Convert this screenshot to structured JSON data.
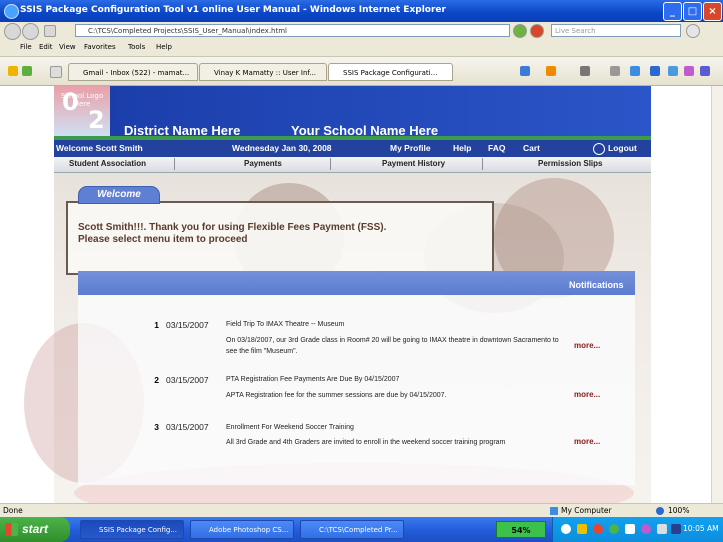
{
  "window": {
    "title": "SSIS Package Configuration Tool v1 online User Manual - Windows Internet Explorer",
    "address": "C:\\TCS\\Completed Projects\\SSIS_User_Manual\\index.html",
    "search_placeholder": "Live Search"
  },
  "menu": [
    "File",
    "Edit",
    "View",
    "Favorites",
    "Tools",
    "Help"
  ],
  "tabs": [
    {
      "label": "Gmail - Inbox (522) - mamat..."
    },
    {
      "label": "Vinay K Mamatty :: User Inf..."
    },
    {
      "label": "SSIS Package Configurati...",
      "active": true
    }
  ],
  "site": {
    "logo_text": "School Logo Here",
    "logo_digits": [
      "0",
      "2"
    ],
    "district": "District Name Here",
    "school": "Your School Name Here",
    "welcome_user": "Welcome Scott Smith",
    "date": "Wednesday Jan 30, 2008",
    "links": [
      "My Profile",
      "Help",
      "FAQ",
      "Cart"
    ],
    "logout": "Logout",
    "nav": [
      "Student Association",
      "Payments",
      "Payment History",
      "Permission Slips"
    ],
    "welcome_tab": "Welcome",
    "welcome_line1": "Scott Smith!!!. Thank you for using Flexible Fees Payment (FSS).",
    "welcome_line2": "Please select menu item to proceed",
    "notifications_title": "Notifications",
    "notifications": [
      {
        "num": "1",
        "date": "03/15/2007",
        "title": "Field Trip To IMAX Theatre -- Museum",
        "desc": "On 03/18/2007, our 3rd Grade class in Room# 20 will be going to IMAX theatre in downtown Sacramento to see the film \"Museum\".",
        "more": "more..."
      },
      {
        "num": "2",
        "date": "03/15/2007",
        "title": "PTA Registration Fee Payments Are Due By 04/15/2007",
        "desc": "APTA Registration fee for the summer sessions are due by 04/15/2007.",
        "more": "more..."
      },
      {
        "num": "3",
        "date": "03/15/2007",
        "title": "Enrollment For Weekend Soccer Training",
        "desc": "All 3rd Grade and 4th Graders are invited to enroll in the weekend soccer training program",
        "more": "more..."
      }
    ]
  },
  "status": {
    "left": "Done",
    "zone": "My Computer",
    "zoom": "100%"
  },
  "taskbar": {
    "start": "start",
    "tasks": [
      {
        "label": "SSIS Package Config..."
      },
      {
        "label": "Adobe Photoshop CS..."
      },
      {
        "label": "C:\\TCS\\Completed Pr..."
      }
    ],
    "battery": "54%",
    "clock": "10:05 AM"
  }
}
